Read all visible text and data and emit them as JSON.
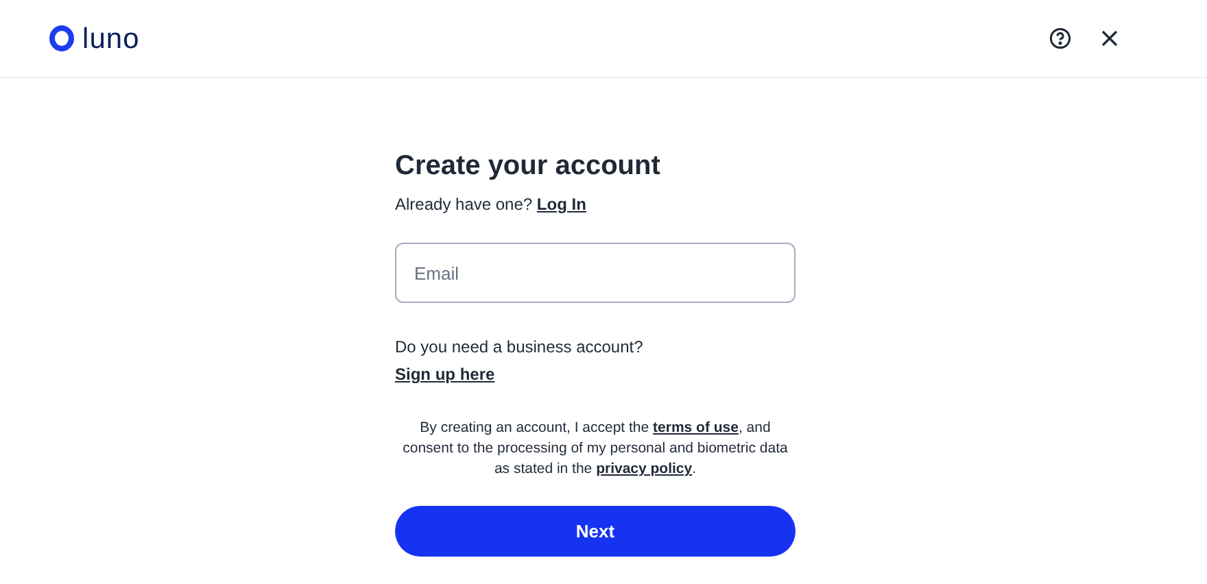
{
  "header": {
    "logo_text": "luno"
  },
  "form": {
    "title": "Create your account",
    "login_prompt": "Already have one?",
    "login_link": "Log In",
    "email": {
      "placeholder": "Email"
    },
    "business_prompt": "Do you need a business account?",
    "business_link": "Sign up here",
    "consent": [
      {
        "kind": "text",
        "text": "By creating an account, I accept the "
      },
      {
        "kind": "link",
        "text": "terms of use"
      },
      {
        "kind": "text",
        "text": ", and consent to the processing of my personal and biometric data as stated in the "
      },
      {
        "kind": "link",
        "text": "privacy policy"
      },
      {
        "kind": "text",
        "text": "."
      }
    ],
    "submit": "Next"
  }
}
